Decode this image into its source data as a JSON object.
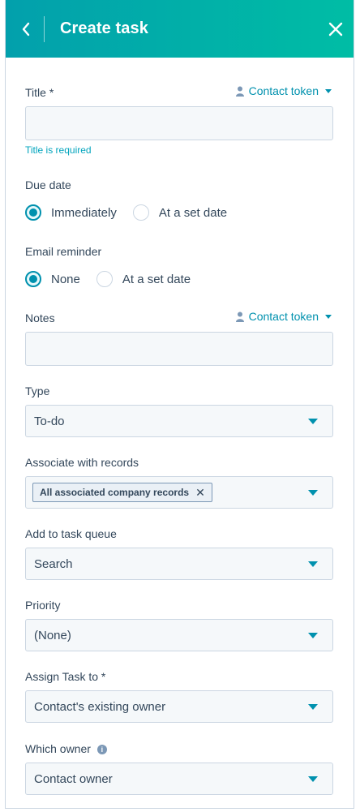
{
  "header": {
    "title": "Create task"
  },
  "fields": {
    "title": {
      "label": "Title *",
      "token": "Contact token",
      "helper": "Title is required"
    },
    "due_date": {
      "label": "Due date",
      "options": [
        "Immediately",
        "At a set date"
      ]
    },
    "email_reminder": {
      "label": "Email reminder",
      "options": [
        "None",
        "At a set date"
      ]
    },
    "notes": {
      "label": "Notes",
      "token": "Contact token"
    },
    "type": {
      "label": "Type",
      "value": "To-do"
    },
    "associate": {
      "label": "Associate with records",
      "chip": "All associated company records"
    },
    "queue": {
      "label": "Add to task queue",
      "value": "Search"
    },
    "priority": {
      "label": "Priority",
      "value": "(None)"
    },
    "assign": {
      "label": "Assign Task to *",
      "value": "Contact's existing owner"
    },
    "owner": {
      "label": "Which owner",
      "value": "Contact owner"
    }
  },
  "colors": {
    "accent": "#0091ae",
    "header_start": "#02a0ac",
    "header_end": "#00bda5",
    "helper": "#00a4bd"
  }
}
